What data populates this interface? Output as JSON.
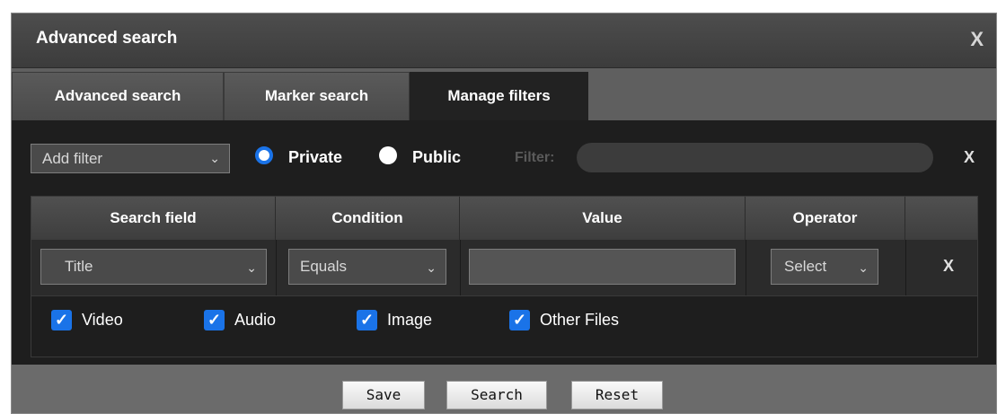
{
  "dialog": {
    "title": "Advanced search",
    "close_glyph": "X"
  },
  "tabs": [
    {
      "label": "Advanced search",
      "active": false
    },
    {
      "label": "Marker search",
      "active": false
    },
    {
      "label": "Manage filters",
      "active": true
    }
  ],
  "toolbar": {
    "add_filter": {
      "value": "Add filter",
      "icon": "chevron-down-icon"
    },
    "visibility": [
      {
        "label": "Private",
        "checked": true
      },
      {
        "label": "Public",
        "checked": false
      }
    ],
    "filter_label": "Filter:",
    "filter_value": "",
    "clear_glyph": "X"
  },
  "table": {
    "headers": [
      "Search field",
      "Condition",
      "Value",
      "Operator",
      ""
    ],
    "row": {
      "search_field": "Title",
      "condition": "Equals",
      "value": "",
      "operator": "Select",
      "remove_glyph": "X"
    }
  },
  "file_types": [
    {
      "label": "Video",
      "checked": true
    },
    {
      "label": "Audio",
      "checked": true
    },
    {
      "label": "Image",
      "checked": true
    },
    {
      "label": "Other Files",
      "checked": true
    }
  ],
  "footer": {
    "save": "Save",
    "search": "Search",
    "reset": "Reset"
  },
  "colors": {
    "accent": "#1a73e8",
    "panel": "#1e1e1e",
    "dialog": "#6b6b6b"
  }
}
